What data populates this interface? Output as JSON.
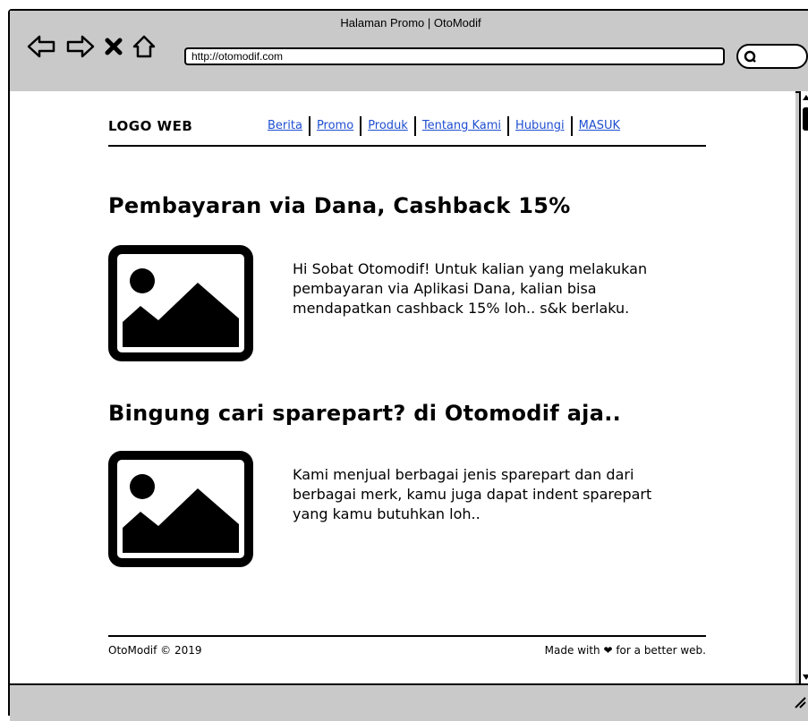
{
  "window": {
    "title": "Halaman Promo | OtoModif",
    "url": "http://otomodif.com"
  },
  "header": {
    "logo": "LOGO WEB",
    "menu": [
      "Berita",
      "Promo",
      "Produk",
      "Tentang Kami",
      "Hubungi",
      "MASUK"
    ]
  },
  "articles": [
    {
      "title": "Pembayaran via Dana, Cashback 15%",
      "text": "Hi Sobat Otomodif! Untuk kalian yang melakukan pembayaran via Aplikasi Dana, kalian bisa mendapatkan cashback 15% loh.. s&k berlaku."
    },
    {
      "title": "Bingung cari sparepart? di Otomodif aja..",
      "text": "Kami menjual berbagai jenis sparepart dan dari berbagai merk, kamu juga dapat indent sparepart yang kamu butuhkan loh.."
    }
  ],
  "footer": {
    "copyright": "OtoModif © 2019",
    "tagline": "Made with ❤ for a better web."
  }
}
